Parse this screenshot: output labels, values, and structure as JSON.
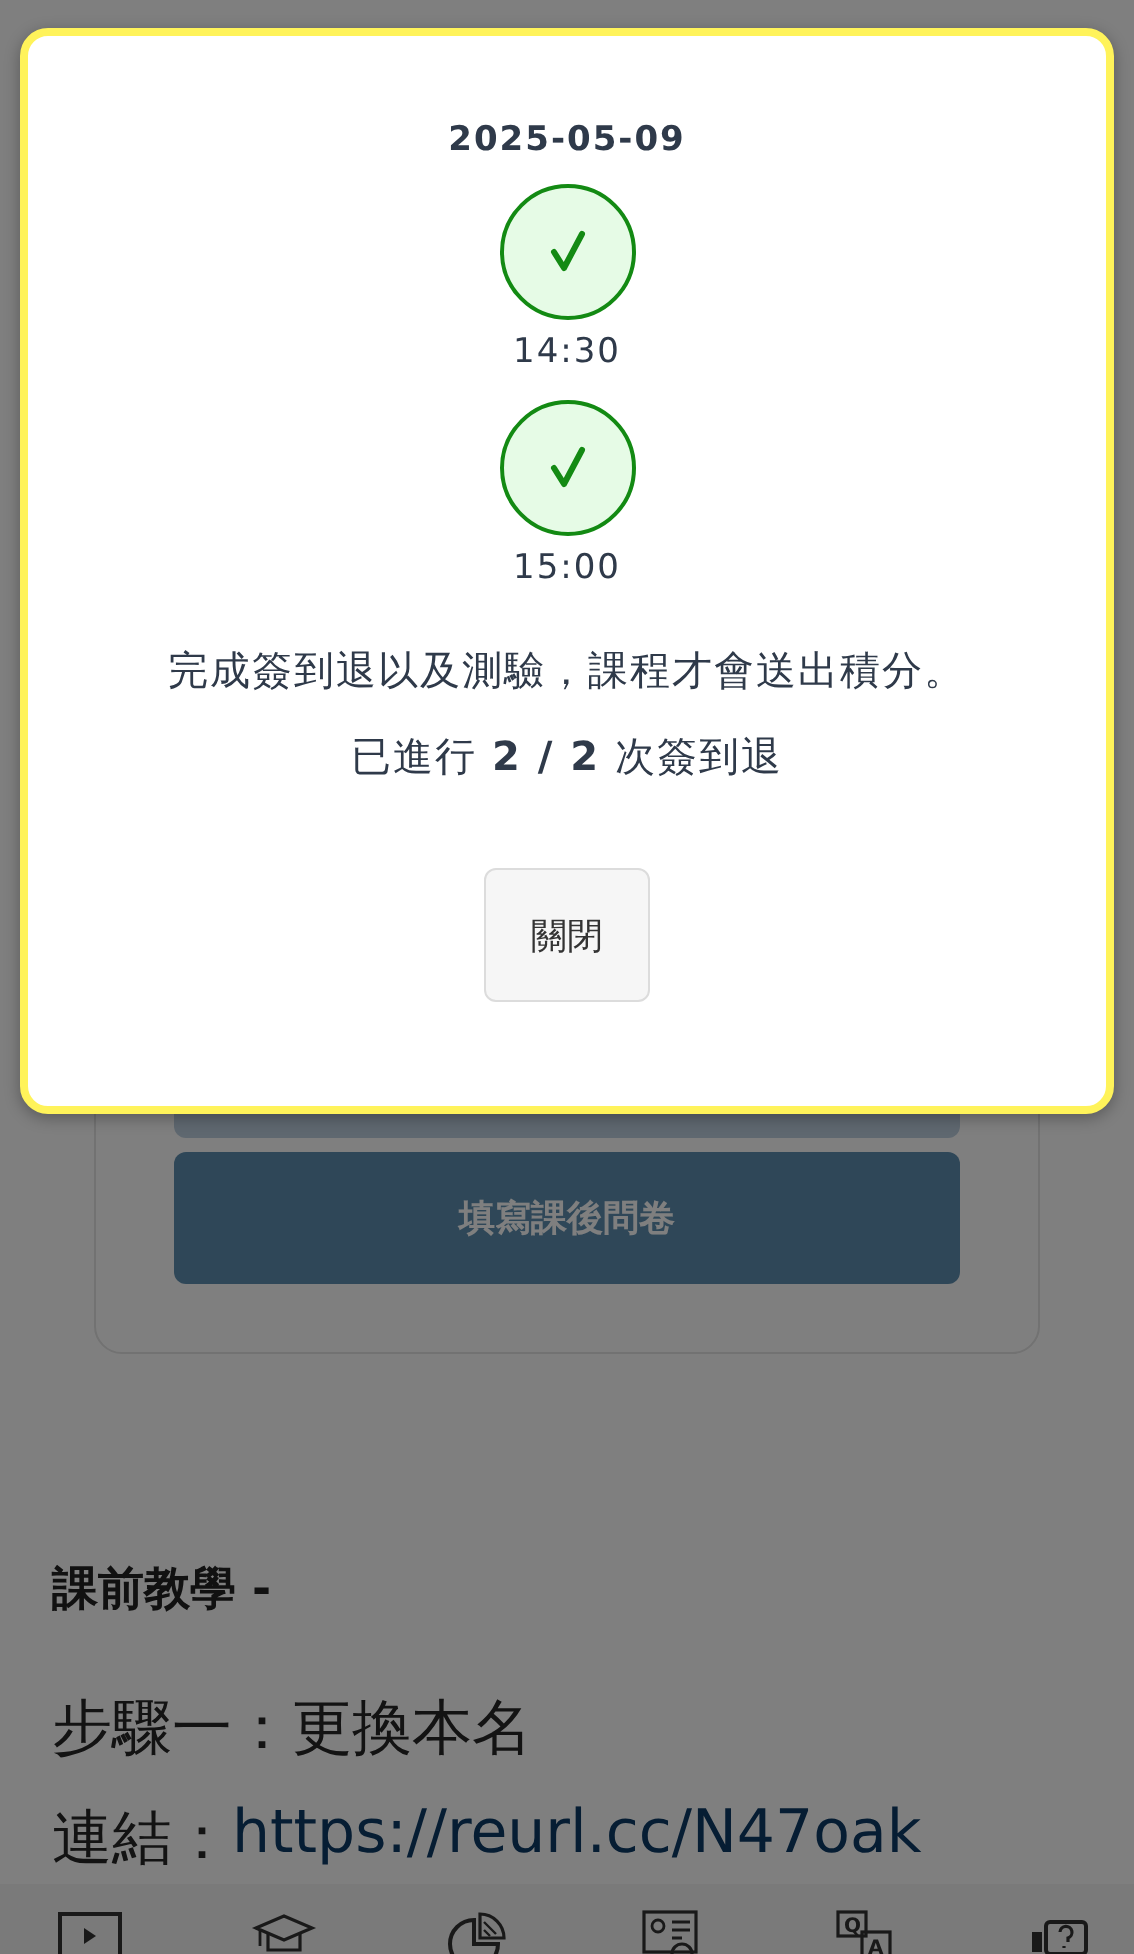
{
  "modal": {
    "date": "2025-05-09",
    "checks": [
      {
        "time": "14:30",
        "done": true
      },
      {
        "time": "15:00",
        "done": true
      }
    ],
    "notice": "完成簽到退以及測驗，課程才會送出積分。",
    "progress": "已進行 **2 / 2** 次簽到退",
    "close_button": "關閉"
  },
  "background": {
    "survey_button": "填寫課後問卷",
    "section_title": "課前教學 -",
    "step": "步驟一：更換本名",
    "link_label": "連結：",
    "link": "https://reurl.cc/N47oak"
  },
  "nav": [
    {
      "kind": "video"
    },
    {
      "kind": "course"
    },
    {
      "kind": "stats"
    },
    {
      "kind": "profile"
    },
    {
      "kind": "qa",
      "labels": [
        "Q",
        "A"
      ]
    },
    {
      "kind": "help"
    }
  ]
}
